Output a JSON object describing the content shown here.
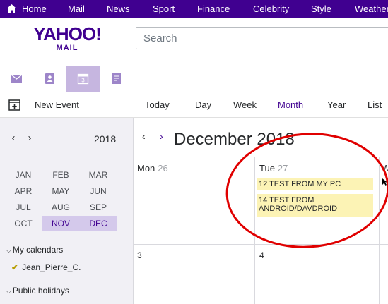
{
  "topnav": {
    "items": [
      {
        "label": "Home"
      },
      {
        "label": "Mail"
      },
      {
        "label": "News"
      },
      {
        "label": "Sport"
      },
      {
        "label": "Finance"
      },
      {
        "label": "Celebrity"
      },
      {
        "label": "Style"
      },
      {
        "label": "Weather"
      }
    ]
  },
  "logo": {
    "yahoo": "YAHOO!",
    "mail": "MAIL"
  },
  "search": {
    "placeholder": "Search"
  },
  "apptabs": [
    {
      "icon": "envelope-icon"
    },
    {
      "icon": "contacts-icon"
    },
    {
      "icon": "calendar-icon",
      "active": true,
      "badge": "3"
    },
    {
      "icon": "notepad-icon"
    }
  ],
  "toolbar": {
    "new_event": "New Event",
    "views": [
      "Today",
      "Day",
      "Week",
      "Month",
      "Year",
      "List"
    ],
    "active_view": "Month"
  },
  "sidebar": {
    "year": "2018",
    "months": [
      "JAN",
      "FEB",
      "MAR",
      "APR",
      "MAY",
      "JUN",
      "JUL",
      "AUG",
      "SEP",
      "OCT",
      "NOV",
      "DEC"
    ],
    "selected_months": [
      "NOV",
      "DEC"
    ],
    "my_calendars": "My calendars",
    "calendar_item": "Jean_Pierre_C.",
    "public_holidays": "Public holidays"
  },
  "calendar": {
    "title": "December 2018",
    "days": [
      {
        "name": "Mon",
        "num": "26"
      },
      {
        "name": "Tue",
        "num": "27"
      },
      {
        "name": "W",
        "num": ""
      }
    ],
    "events": [
      {
        "text": "12 TEST FROM MY PC"
      },
      {
        "text": "14 TEST FROM ANDROID/DAVDROID"
      }
    ],
    "next_row_dates": [
      "3",
      "4"
    ]
  },
  "colors": {
    "brand": "#400090",
    "event_bg": "#fcf3b5",
    "annotation": "#e00000"
  }
}
